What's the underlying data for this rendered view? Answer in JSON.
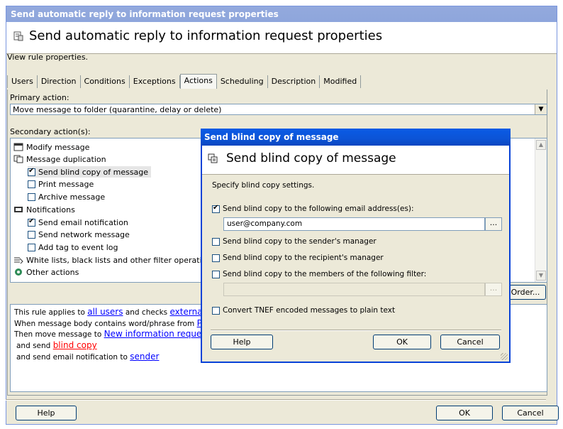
{
  "window": {
    "titlebar": "Send automatic reply to information request properties",
    "header_title": "Send automatic reply to information request properties",
    "description": "View rule properties."
  },
  "tabs": [
    "Users",
    "Direction",
    "Conditions",
    "Exceptions",
    "Actions",
    "Scheduling",
    "Description",
    "Modified"
  ],
  "active_tab": "Actions",
  "primary": {
    "label": "Primary action:",
    "value": "Move message to folder (quarantine, delay or delete)"
  },
  "secondary": {
    "label": "Secondary action(s):",
    "items": {
      "modify": "Modify message",
      "duplication": "Message duplication",
      "blind_copy": "Send blind copy of message",
      "print": "Print message",
      "archive": "Archive message",
      "notifications": "Notifications",
      "email_notification": "Send email notification",
      "network_message": "Send network message",
      "event_log": "Add tag to event log",
      "white_lists": "White lists, black lists and other filter operations",
      "other": "Other actions"
    }
  },
  "order_button": "Order...",
  "rule_text": {
    "l1_a": "This rule applies to ",
    "l1_link1": "all users",
    "l1_b": " and checks ",
    "l1_link2": "externally",
    "l2_a": "When message body contains word/phrase from ",
    "l2_link": "Prod",
    "l3_a": "Then move message to ",
    "l3_link": "New information requests",
    "l4_a": "and send ",
    "l4_link": "blind copy",
    "l5_a": "and send email notification to ",
    "l5_link": "sender"
  },
  "main_buttons": {
    "help": "Help",
    "ok": "OK",
    "cancel": "Cancel"
  },
  "dialog": {
    "titlebar": "Send blind copy of message",
    "header_title": "Send blind copy of message",
    "description": "Specify blind copy settings.",
    "opt_email": "Send blind copy to the following email address(es):",
    "email_value": "user@company.com",
    "ellipsis": "...",
    "opt_sender_manager": "Send blind copy to the sender's manager",
    "opt_recipient_manager": "Send blind copy to the recipient's manager",
    "opt_filter": "Send blind copy to the members of the following filter:",
    "opt_tnef": "Convert TNEF encoded messages to plain text",
    "buttons": {
      "help": "Help",
      "ok": "OK",
      "cancel": "Cancel"
    }
  },
  "colors": {
    "dialog_title": "#0c54d6",
    "main_title": "#8ea6dc",
    "link": "#0000ff",
    "link_alert": "#ff0000"
  }
}
